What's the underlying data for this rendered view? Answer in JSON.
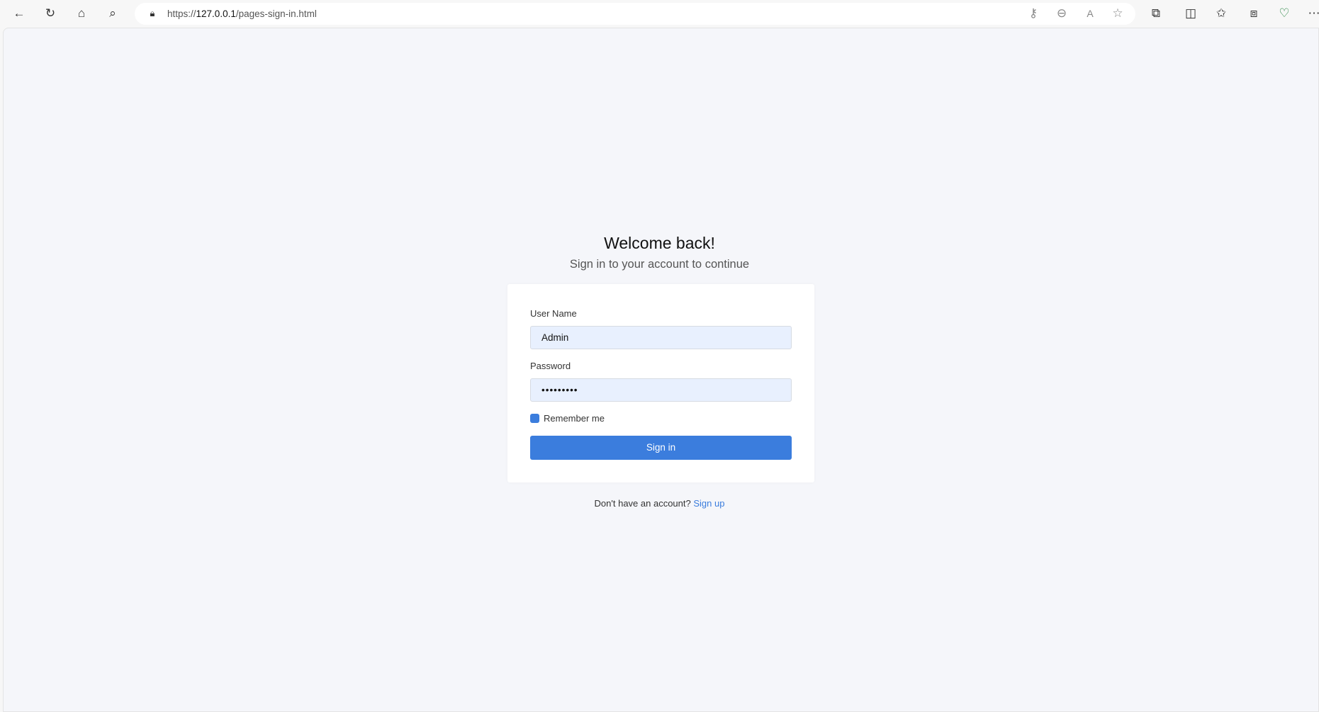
{
  "browser": {
    "url_prefix": "https://",
    "url_host": "127.0.0.1",
    "url_path": "/pages-sign-in.html",
    "icons": [
      "back-icon",
      "reload-icon",
      "home-icon",
      "search-icon",
      "lock-icon",
      "key-icon",
      "zoom-out-icon",
      "read-aloud-icon",
      "favorite-star-icon",
      "extensions-icon",
      "split-screen-icon",
      "favorites-icon",
      "collections-icon",
      "browser-essentials-icon",
      "more-icon"
    ]
  },
  "page": {
    "title": "Welcome back!",
    "subtitle": "Sign in to your account to continue",
    "form": {
      "username_label": "User Name",
      "username_value": "Admin",
      "password_label": "Password",
      "password_value": "•••••••••",
      "remember_label": "Remember me",
      "remember_checked": true,
      "submit_label": "Sign in"
    },
    "footer": {
      "text": "Don't have an account?",
      "link": "Sign up"
    }
  },
  "colors": {
    "accent": "#3b7ddd",
    "input_bg": "#e8f0fe",
    "page_bg": "#f5f6fa"
  }
}
